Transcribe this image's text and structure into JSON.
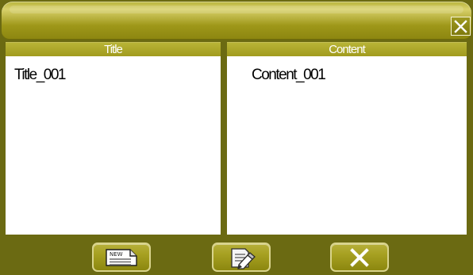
{
  "window": {
    "close_icon": "close-icon"
  },
  "columns": {
    "title_header": "Title",
    "content_header": "Content"
  },
  "rows": [
    {
      "title": "Title_001",
      "content": "Content_001"
    }
  ],
  "toolbar": {
    "new_icon": "new-icon",
    "edit_icon": "edit-icon",
    "delete_icon": "delete-icon",
    "new_label": "NEW"
  },
  "colors": {
    "frame": "#6b6a12",
    "header": "#b8b436",
    "button": "#a6a021",
    "text": "#000000",
    "white": "#ffffff"
  }
}
